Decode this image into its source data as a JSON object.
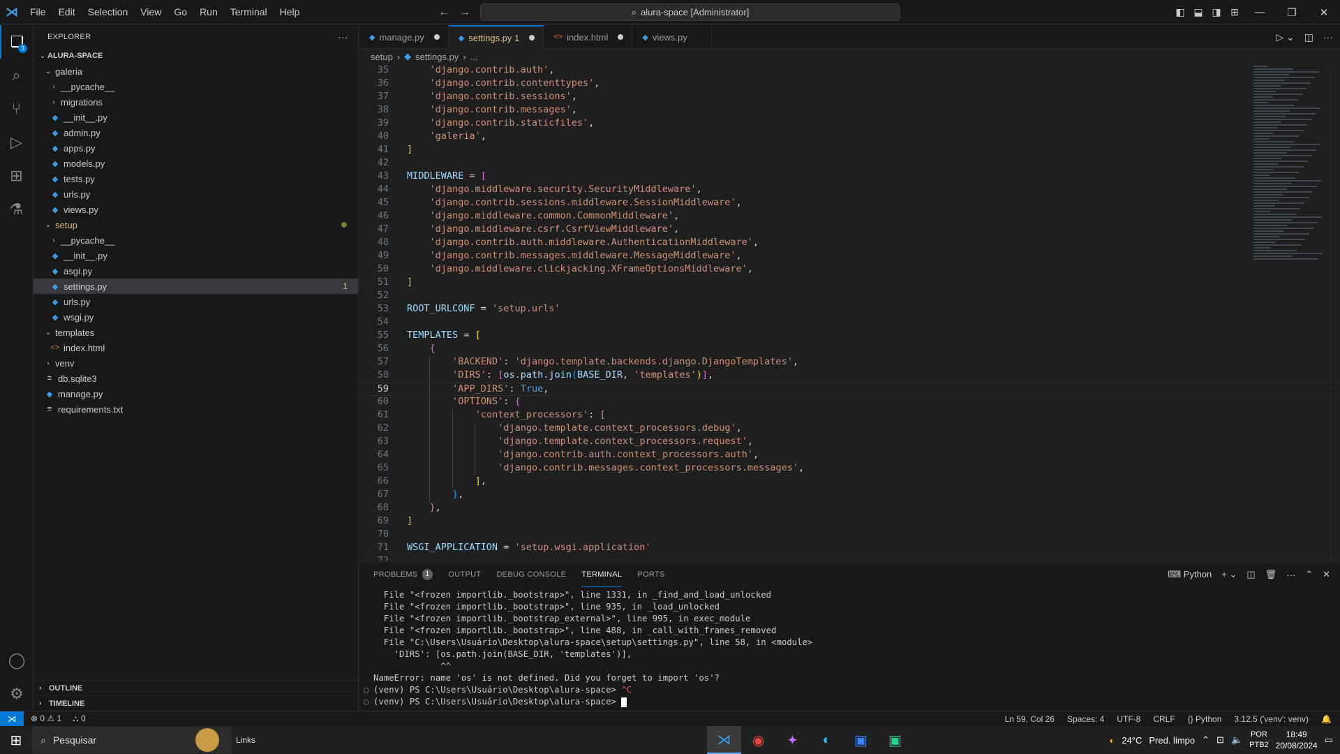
{
  "titlebar": {
    "menu": [
      "File",
      "Edit",
      "Selection",
      "View",
      "Go",
      "Run",
      "Terminal",
      "Help"
    ],
    "search": "alura-space [Administrator]"
  },
  "activity": {
    "explorer_badge": "3"
  },
  "sidebar": {
    "title": "EXPLORER",
    "root": "ALURA-SPACE",
    "items": [
      {
        "label": "galeria",
        "type": "folder-open",
        "depth": 1
      },
      {
        "label": "__pycache__",
        "type": "folder",
        "depth": 2
      },
      {
        "label": "migrations",
        "type": "folder",
        "depth": 2
      },
      {
        "label": "__init__.py",
        "type": "py",
        "depth": 2
      },
      {
        "label": "admin.py",
        "type": "py",
        "depth": 2
      },
      {
        "label": "apps.py",
        "type": "py",
        "depth": 2
      },
      {
        "label": "models.py",
        "type": "py",
        "depth": 2
      },
      {
        "label": "tests.py",
        "type": "py",
        "depth": 2
      },
      {
        "label": "urls.py",
        "type": "py",
        "depth": 2
      },
      {
        "label": "views.py",
        "type": "py",
        "depth": 2
      },
      {
        "label": "setup",
        "type": "folder-open",
        "depth": 1,
        "modified": true
      },
      {
        "label": "__pycache__",
        "type": "folder",
        "depth": 2
      },
      {
        "label": "__init__.py",
        "type": "py",
        "depth": 2
      },
      {
        "label": "asgi.py",
        "type": "py",
        "depth": 2
      },
      {
        "label": "settings.py",
        "type": "py",
        "depth": 2,
        "selected": true,
        "badge": "1"
      },
      {
        "label": "urls.py",
        "type": "py",
        "depth": 2
      },
      {
        "label": "wsgi.py",
        "type": "py",
        "depth": 2
      },
      {
        "label": "templates",
        "type": "folder-open",
        "depth": 1
      },
      {
        "label": "index.html",
        "type": "html",
        "depth": 2
      },
      {
        "label": "venv",
        "type": "folder",
        "depth": 1
      },
      {
        "label": "db.sqlite3",
        "type": "txt",
        "depth": 1
      },
      {
        "label": "manage.py",
        "type": "py",
        "depth": 1
      },
      {
        "label": "requirements.txt",
        "type": "txt",
        "depth": 1
      }
    ],
    "outline": "OUTLINE",
    "timeline": "TIMELINE"
  },
  "tabs": [
    {
      "label": "manage.py",
      "type": "py",
      "modified": true
    },
    {
      "label": "settings.py 1",
      "type": "py",
      "modified": true,
      "active": true
    },
    {
      "label": "index.html",
      "type": "html",
      "modified": true
    },
    {
      "label": "views.py",
      "type": "py",
      "modified": false
    }
  ],
  "breadcrumb": [
    "setup",
    "settings.py",
    "..."
  ],
  "code": {
    "current": 59,
    "lines": [
      {
        "n": "35",
        "t": "    'django.contrib.auth',"
      },
      {
        "n": "36",
        "t": "    'django.contrib.contenttypes',"
      },
      {
        "n": "37",
        "t": "    'django.contrib.sessions',"
      },
      {
        "n": "38",
        "t": "    'django.contrib.messages',"
      },
      {
        "n": "39",
        "t": "    'django.contrib.staticfiles',"
      },
      {
        "n": "40",
        "t": "    'galeria',"
      },
      {
        "n": "41",
        "t": "]"
      },
      {
        "n": "42",
        "t": ""
      },
      {
        "n": "43",
        "t": "MIDDLEWARE = ["
      },
      {
        "n": "44",
        "t": "    'django.middleware.security.SecurityMiddleware',"
      },
      {
        "n": "45",
        "t": "    'django.contrib.sessions.middleware.SessionMiddleware',"
      },
      {
        "n": "46",
        "t": "    'django.middleware.common.CommonMiddleware',"
      },
      {
        "n": "47",
        "t": "    'django.middleware.csrf.CsrfViewMiddleware',"
      },
      {
        "n": "48",
        "t": "    'django.contrib.auth.middleware.AuthenticationMiddleware',"
      },
      {
        "n": "49",
        "t": "    'django.contrib.messages.middleware.MessageMiddleware',"
      },
      {
        "n": "50",
        "t": "    'django.middleware.clickjacking.XFrameOptionsMiddleware',"
      },
      {
        "n": "51",
        "t": "]"
      },
      {
        "n": "52",
        "t": ""
      },
      {
        "n": "53",
        "t": "ROOT_URLCONF = 'setup.urls'"
      },
      {
        "n": "54",
        "t": ""
      },
      {
        "n": "55",
        "t": "TEMPLATES = ["
      },
      {
        "n": "56",
        "t": "    {"
      },
      {
        "n": "57",
        "t": "        'BACKEND': 'django.template.backends.django.DjangoTemplates',"
      },
      {
        "n": "58",
        "t": "        'DIRS': [os.path.join(BASE_DIR, 'templates')],"
      },
      {
        "n": "59",
        "t": "        'APP_DIRS': True,"
      },
      {
        "n": "60",
        "t": "        'OPTIONS': {"
      },
      {
        "n": "61",
        "t": "            'context_processors': ["
      },
      {
        "n": "62",
        "t": "                'django.template.context_processors.debug',"
      },
      {
        "n": "63",
        "t": "                'django.template.context_processors.request',"
      },
      {
        "n": "64",
        "t": "                'django.contrib.auth.context_processors.auth',"
      },
      {
        "n": "65",
        "t": "                'django.contrib.messages.context_processors.messages',"
      },
      {
        "n": "66",
        "t": "            ],"
      },
      {
        "n": "67",
        "t": "        },"
      },
      {
        "n": "68",
        "t": "    },"
      },
      {
        "n": "69",
        "t": "]"
      },
      {
        "n": "70",
        "t": ""
      },
      {
        "n": "71",
        "t": "WSGI_APPLICATION = 'setup.wsgi.application'"
      },
      {
        "n": "72",
        "t": ""
      }
    ]
  },
  "panel": {
    "tabs": [
      "PROBLEMS",
      "OUTPUT",
      "DEBUG CONSOLE",
      "TERMINAL",
      "PORTS"
    ],
    "problems_count": "1",
    "active": "TERMINAL",
    "shell": "Python",
    "lines": [
      "  File \"<frozen importlib._bootstrap>\", line 1331, in _find_and_load_unlocked",
      "  File \"<frozen importlib._bootstrap>\", line 935, in _load_unlocked",
      "  File \"<frozen importlib._bootstrap_external>\", line 995, in exec_module",
      "  File \"<frozen importlib._bootstrap>\", line 488, in _call_with_frames_removed",
      "  File \"C:\\Users\\Usuário\\Desktop\\alura-space\\setup\\settings.py\", line 58, in <module>",
      "    'DIRS': [os.path.join(BASE_DIR, 'templates')],",
      "             ^^",
      "NameError: name 'os' is not defined. Did you forget to import 'os'?"
    ],
    "prompt1": "(venv) PS C:\\Users\\Usuário\\Desktop\\alura-space> ",
    "interrupt": "^C",
    "prompt2": "(venv) PS C:\\Users\\Usuário\\Desktop\\alura-space> "
  },
  "status": {
    "errors": "0",
    "warnings": "1",
    "ports": "0",
    "position": "Ln 59, Col 26",
    "spaces": "Spaces: 4",
    "encoding": "UTF-8",
    "eol": "CRLF",
    "language": "Python",
    "interpreter": "3.12.5 ('venv': venv)"
  },
  "taskbar": {
    "search": "Pesquisar",
    "links": "Links",
    "weather": "24°C",
    "weather_text": "Pred. limpo",
    "lang1": "POR",
    "lang2": "PTB2",
    "time": "18:49",
    "date": "20/08/2024"
  }
}
